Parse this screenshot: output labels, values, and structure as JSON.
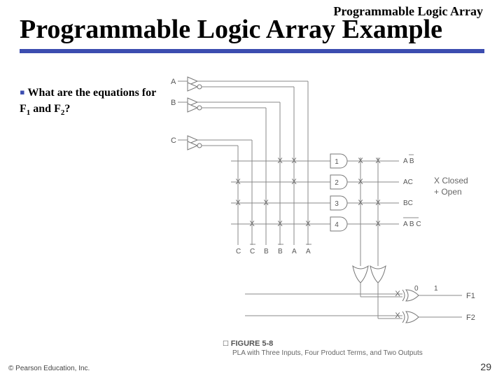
{
  "header_small": "Programmable Logic Array",
  "title": "Programmable Logic Array Example",
  "bullet": {
    "text_before": "What are the equations for F",
    "sub1": "1",
    "mid": " and F",
    "sub2": "2",
    "after": "?"
  },
  "footer_left": "© Pearson Education, Inc.",
  "page_number": "29",
  "diagram": {
    "inputs": [
      "A",
      "B",
      "C"
    ],
    "vertical_labels": [
      "C",
      "C",
      "B",
      "B",
      "A",
      "A"
    ],
    "and_gates": [
      "1",
      "2",
      "3",
      "4"
    ],
    "product_terms": [
      "A B",
      "AC",
      "BC",
      "A B C"
    ],
    "legend": {
      "closed": "X  Closed",
      "open": "+  Open"
    },
    "or_fuses": [
      "0",
      "1"
    ],
    "outputs": [
      "F1",
      "F2"
    ],
    "figure_caption": "FIGURE 5-8",
    "figure_sub": "PLA with Three Inputs, Four Product Terms, and Two Outputs"
  },
  "chart_data": {
    "type": "table",
    "description": "PLA connection matrix (X = closed/connected)",
    "columns": [
      "C",
      "C'",
      "B",
      "B'",
      "A",
      "A'"
    ],
    "products": [
      {
        "id": 1,
        "term": "A B'",
        "conn": [
          0,
          0,
          0,
          1,
          1,
          0
        ]
      },
      {
        "id": 2,
        "term": "A C",
        "conn": [
          1,
          0,
          0,
          0,
          1,
          0
        ]
      },
      {
        "id": 3,
        "term": "B C",
        "conn": [
          1,
          0,
          1,
          0,
          0,
          0
        ]
      },
      {
        "id": 4,
        "term": "A' B' C'",
        "conn": [
          0,
          1,
          0,
          1,
          0,
          1
        ]
      }
    ],
    "or_plane": {
      "F1": [
        1,
        1,
        1,
        0
      ],
      "F2": [
        1,
        0,
        1,
        1
      ]
    },
    "xor_fuse": {
      "F1": 0,
      "F2": 1
    }
  }
}
